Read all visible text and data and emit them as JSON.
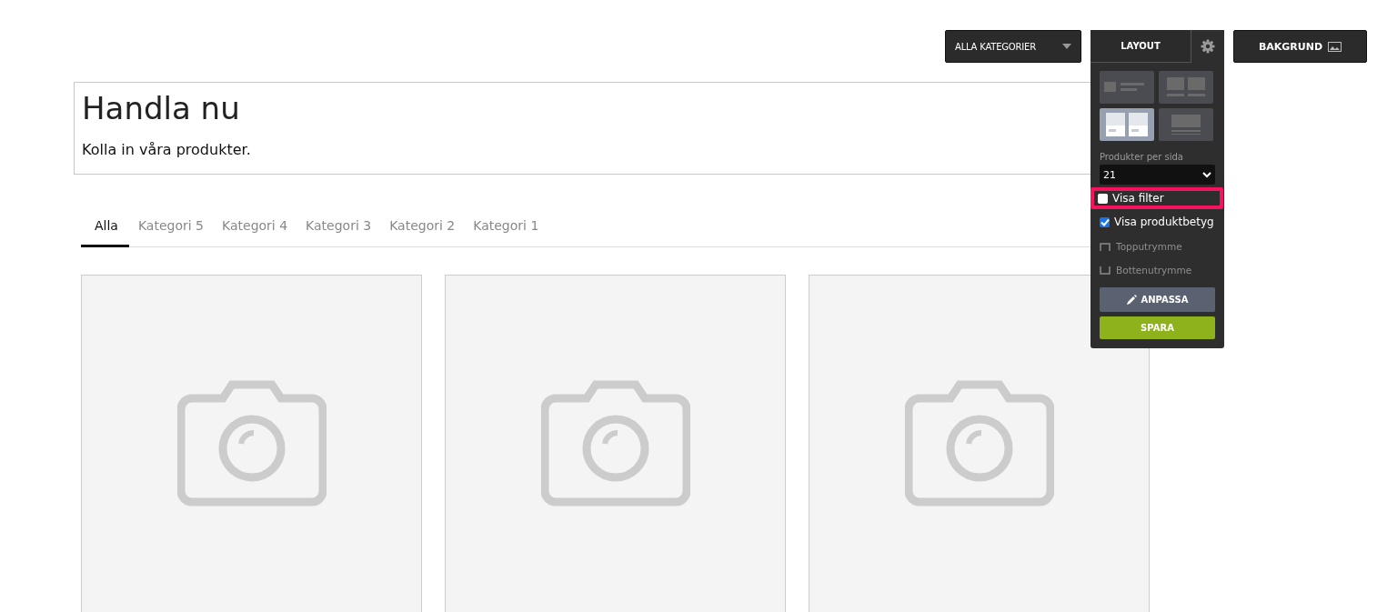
{
  "toolbar": {
    "category_dropdown": "ALLA KATEGORIER",
    "layout_tab": "LAYOUT",
    "background_button": "BAKGRUND"
  },
  "layout_panel": {
    "open": true,
    "layouts": [
      {
        "kind": "list",
        "selected": false
      },
      {
        "kind": "grid-two",
        "selected": false
      },
      {
        "kind": "cards",
        "selected": true
      },
      {
        "kind": "wide",
        "selected": false
      }
    ],
    "per_page_label": "Produkter per sida",
    "per_page_value": "21",
    "options": [
      {
        "kind": "checkbox",
        "label": "Visa filter",
        "checked": false,
        "highlighted": true
      },
      {
        "kind": "checkbox",
        "label": "Visa produktbetyg",
        "checked": true,
        "highlighted": false
      },
      {
        "kind": "top-space",
        "label": "Topputrymme"
      },
      {
        "kind": "bottom-space",
        "label": "Bottenutrymme"
      }
    ],
    "customize_button": "ANPASSA",
    "save_button": "SPARA"
  },
  "header": {
    "title": "Handla nu",
    "subtitle": "Kolla in våra produkter."
  },
  "tabs": [
    {
      "label": "Alla",
      "selected": true
    },
    {
      "label": "Kategori 5",
      "selected": false
    },
    {
      "label": "Kategori 4",
      "selected": false
    },
    {
      "label": "Kategori 3",
      "selected": false
    },
    {
      "label": "Kategori 2",
      "selected": false
    },
    {
      "label": "Kategori 1",
      "selected": false
    }
  ],
  "products": [
    {
      "kind": "placeholder"
    },
    {
      "kind": "placeholder"
    },
    {
      "kind": "placeholder"
    }
  ]
}
